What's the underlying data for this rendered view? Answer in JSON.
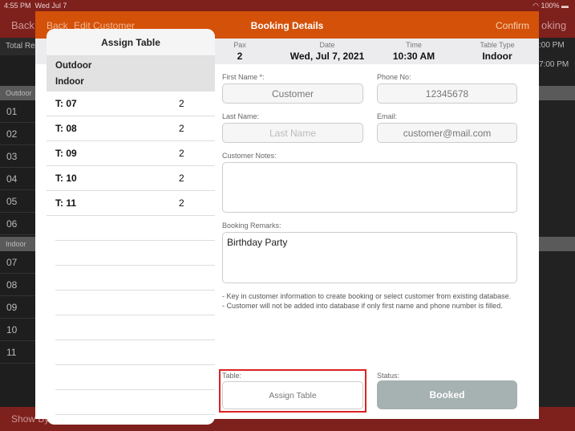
{
  "status_bar": {
    "time": "4:55 PM",
    "date": "Wed Jul 7",
    "battery": "100%"
  },
  "background": {
    "back": "Back",
    "booking": "oking",
    "total": "Total Re",
    "sections": [
      "Outdoor",
      "Indoor"
    ],
    "outdoor_rows": [
      "01",
      "02",
      "03",
      "04",
      "05",
      "06"
    ],
    "indoor_rows": [
      "07",
      "08",
      "09",
      "10",
      "11"
    ],
    "times": [
      ":00 PM",
      "7:00 PM"
    ],
    "bottom": "Show By"
  },
  "modal": {
    "back": "Back",
    "edit_customer": "Edit Customer",
    "title": "Booking Details",
    "confirm": "Confirm",
    "info": [
      {
        "label": "Pax",
        "value": "2"
      },
      {
        "label": "Date",
        "value": "Wed, Jul 7, 2021"
      },
      {
        "label": "Time",
        "value": "10:30 AM"
      },
      {
        "label": "Table Type",
        "value": "Indoor"
      }
    ],
    "first_name_label": "First Name *:",
    "first_name": "Customer",
    "phone_label": "Phone No:",
    "phone": "12345678",
    "last_name_label": "Last Name:",
    "last_name_placeholder": "Last Name",
    "email_label": "Email:",
    "email": "customer@mail.com",
    "customer_notes_label": "Customer Notes:",
    "customer_notes": "",
    "remarks_label": "Booking Remarks:",
    "remarks": "Birthday Party",
    "note1": "- Key in customer information to create booking or select customer from existing database.",
    "note2": "- Customer will not be added into database if only first name and phone number is filled.",
    "table_label": "Table:",
    "assign_table": "Assign Table",
    "status_label": "Status:",
    "status": "Booked"
  },
  "popover": {
    "title": "Assign Table",
    "segments": [
      "Outdoor",
      "Indoor"
    ],
    "tables": [
      {
        "name": "T: 07",
        "pax": "2"
      },
      {
        "name": "T: 08",
        "pax": "2"
      },
      {
        "name": "T: 09",
        "pax": "2"
      },
      {
        "name": "T: 10",
        "pax": "2"
      },
      {
        "name": "T: 11",
        "pax": "2"
      }
    ]
  },
  "colors": {
    "header": "#d4510a",
    "app_bar": "#7e201c",
    "highlight": "#dd2222",
    "booked": "#a6b1b1"
  }
}
